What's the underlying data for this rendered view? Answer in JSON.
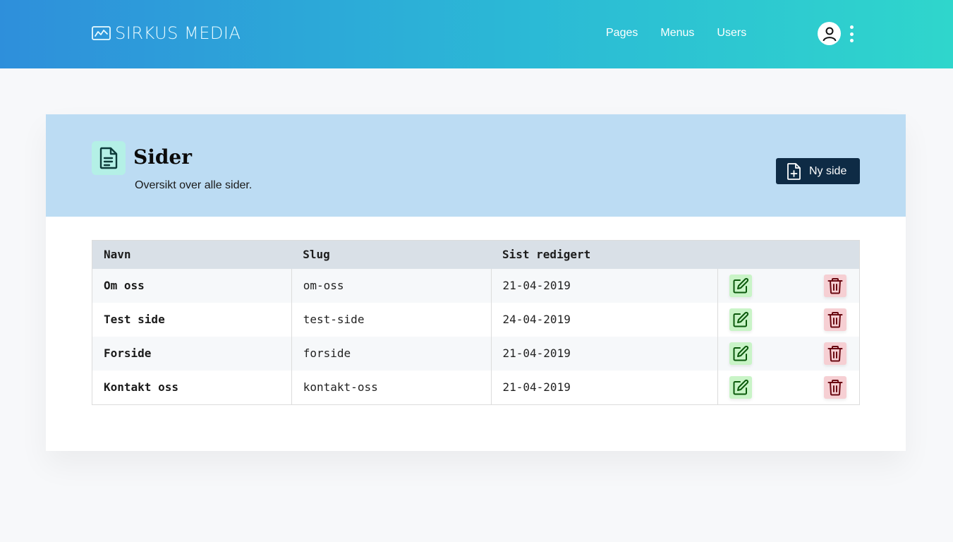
{
  "header": {
    "brand": "SIRKUS MEDIA",
    "brand_icon": "chart-line-icon",
    "nav": [
      {
        "label": "Pages"
      },
      {
        "label": "Menus"
      },
      {
        "label": "Users"
      }
    ],
    "avatar_icon": "user-icon",
    "menu_icon": "kebab-menu-icon"
  },
  "page": {
    "icon": "document-icon",
    "title": "Sider",
    "subtitle": "Oversikt over alle sider.",
    "new_button": {
      "label": "Ny side",
      "icon": "file-plus-icon"
    }
  },
  "table": {
    "columns": [
      "Navn",
      "Slug",
      "Sist redigert"
    ],
    "rows": [
      {
        "name": "Om oss",
        "slug": "om-oss",
        "edited": "21-04-2019"
      },
      {
        "name": "Test side",
        "slug": "test-side",
        "edited": "24-04-2019"
      },
      {
        "name": "Forside",
        "slug": "forside",
        "edited": "21-04-2019"
      },
      {
        "name": "Kontakt oss",
        "slug": "kontakt-oss",
        "edited": "21-04-2019"
      }
    ],
    "edit_icon": "edit-icon",
    "delete_icon": "trash-icon"
  },
  "colors": {
    "header_gradient_start": "#2e8fdb",
    "header_gradient_end": "#2fd6cc",
    "card_header_bg": "#bcdcf3",
    "primary_button": "#0e2b45",
    "edit_bg": "#c9f4c7",
    "edit_fg": "#0c5a0c",
    "delete_bg": "#f6cfd3",
    "delete_fg": "#6a0a12"
  }
}
